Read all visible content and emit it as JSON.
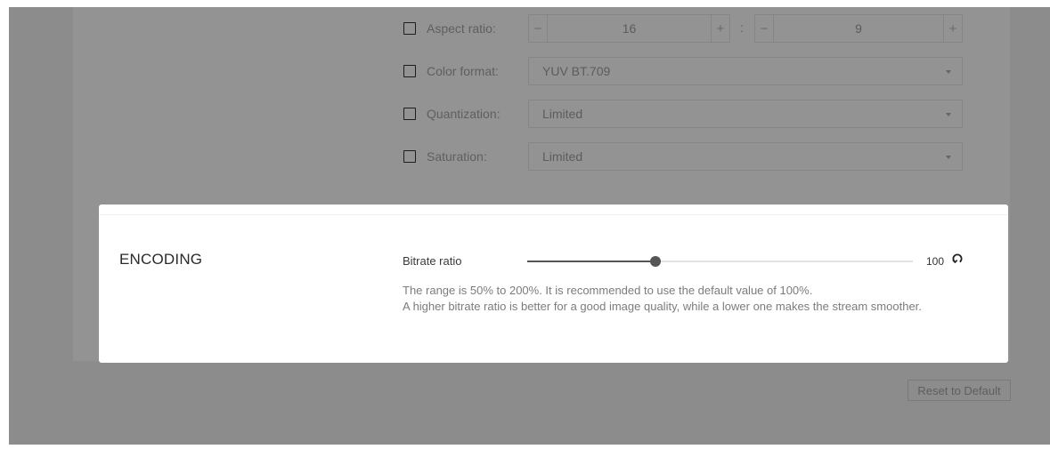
{
  "video": {
    "aspect_ratio": {
      "label": "Aspect ratio:",
      "width": "16",
      "height": "9",
      "minus": "−",
      "plus": "+",
      "separator": ":"
    },
    "color_format": {
      "label": "Color format:",
      "value": "YUV BT.709"
    },
    "quantization": {
      "label": "Quantization:",
      "value": "Limited"
    },
    "saturation": {
      "label": "Saturation:",
      "value": "Limited"
    }
  },
  "encoding": {
    "title": "ENCODING",
    "bitrate_label": "Bitrate ratio",
    "bitrate_value": "100",
    "bitrate_fraction": 0.333,
    "desc_line1": "The range is 50% to 200%. It is recommended to use the default value of 100%.",
    "desc_line2": "A higher bitrate ratio is better for a good image quality, while a lower one makes the stream smoother."
  },
  "footer": {
    "reset_label": "Reset to Default"
  }
}
